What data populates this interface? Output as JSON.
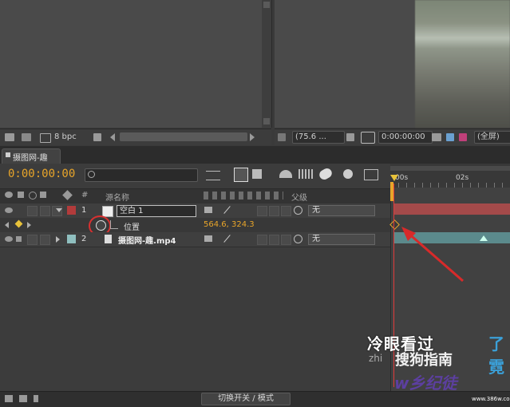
{
  "top_left": {
    "bpc": "8 bpc"
  },
  "viewer": {
    "zoom": "(75.6 ...",
    "timecode": "0:00:00:00",
    "resolution": "(全屏)"
  },
  "tab": {
    "label": "摄图网-趣"
  },
  "timeline": {
    "current_time": "0:00:00:00",
    "columns": {
      "number": "#",
      "source_name": "源名称",
      "parent": "父级"
    },
    "layers": [
      {
        "number": "1",
        "name": "空白 1",
        "parent": "无",
        "label_color": "#b23b3b"
      },
      {
        "number": "2",
        "name": "摄图网-趣.mp4",
        "parent": "无",
        "label_color": "#8fbfbf"
      }
    ],
    "property": {
      "name": "位置",
      "value": "564.6, 324.3"
    },
    "ruler": {
      "start": "00s",
      "mark": "02s"
    }
  },
  "footer": {
    "toggle_label": "切换开关 / 模式"
  },
  "overlay": {
    "subtitle_white": "冷眼看过",
    "subtitle_blue": "了霓",
    "watermark_zhi": "zhi",
    "watermark_search": "搜狗指南",
    "watermark_site": "w乡纪徒",
    "watermark_url": "www.386w.com"
  },
  "colors": {
    "timecode": "#e8a52a",
    "playhead": "#e03a3a",
    "layer1_bar": "#a44a4a",
    "layer2_bar": "#5b8a8c"
  }
}
